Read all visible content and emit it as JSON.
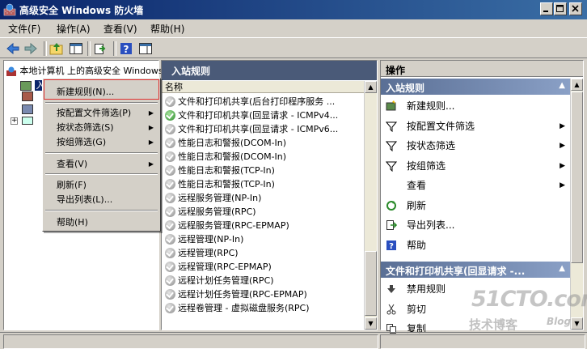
{
  "window": {
    "title": "高级安全 Windows 防火墙"
  },
  "menubar": [
    {
      "label": "文件(F)"
    },
    {
      "label": "操作(A)"
    },
    {
      "label": "查看(V)"
    },
    {
      "label": "帮助(H)"
    }
  ],
  "tree": {
    "root_label": "本地计算机 上的高级安全 Windows",
    "selected_label": "入站规则"
  },
  "context_menu": {
    "items": [
      {
        "label": "新建规则(N)...",
        "submenu": false
      },
      {
        "label": "按配置文件筛选(P)",
        "submenu": true
      },
      {
        "label": "按状态筛选(S)",
        "submenu": true
      },
      {
        "label": "按组筛选(G)",
        "submenu": true
      },
      {
        "label": "查看(V)",
        "submenu": true
      },
      {
        "label": "刷新(F)",
        "submenu": false
      },
      {
        "label": "导出列表(L)...",
        "submenu": false
      },
      {
        "label": "帮助(H)",
        "submenu": false
      }
    ]
  },
  "middle": {
    "title": "入站规则",
    "column_name": "名称",
    "rules": [
      {
        "name": "文件和打印机共享(后台打印程序服务 ...",
        "enabled": false
      },
      {
        "name": "文件和打印机共享(回显请求 - ICMPv4...",
        "enabled": true
      },
      {
        "name": "文件和打印机共享(回显请求 - ICMPv6...",
        "enabled": false
      },
      {
        "name": "性能日志和警报(DCOM-In)",
        "enabled": false
      },
      {
        "name": "性能日志和警报(DCOM-In)",
        "enabled": false
      },
      {
        "name": "性能日志和警报(TCP-In)",
        "enabled": false
      },
      {
        "name": "性能日志和警报(TCP-In)",
        "enabled": false
      },
      {
        "name": "远程服务管理(NP-In)",
        "enabled": false
      },
      {
        "name": "远程服务管理(RPC)",
        "enabled": false
      },
      {
        "name": "远程服务管理(RPC-EPMAP)",
        "enabled": false
      },
      {
        "name": "远程管理(NP-In)",
        "enabled": false
      },
      {
        "name": "远程管理(RPC)",
        "enabled": false
      },
      {
        "name": "远程管理(RPC-EPMAP)",
        "enabled": false
      },
      {
        "name": "远程计划任务管理(RPC)",
        "enabled": false
      },
      {
        "name": "远程计划任务管理(RPC-EPMAP)",
        "enabled": false
      },
      {
        "name": "远程卷管理 - 虚拟磁盘服务(RPC)",
        "enabled": false
      }
    ]
  },
  "actions": {
    "header": "操作",
    "section1": {
      "title": "入站规则",
      "items": [
        {
          "label": "新建规则...",
          "icon": "new-rule-icon",
          "submenu": false
        },
        {
          "label": "按配置文件筛选",
          "icon": "filter-icon",
          "submenu": true
        },
        {
          "label": "按状态筛选",
          "icon": "filter-icon",
          "submenu": true
        },
        {
          "label": "按组筛选",
          "icon": "filter-icon",
          "submenu": true
        },
        {
          "label": "查看",
          "icon": "view-icon",
          "submenu": true
        },
        {
          "label": "刷新",
          "icon": "refresh-icon",
          "submenu": false
        },
        {
          "label": "导出列表...",
          "icon": "export-icon",
          "submenu": false
        },
        {
          "label": "帮助",
          "icon": "help-icon",
          "submenu": false
        }
      ]
    },
    "section2": {
      "title": "文件和打印机共享(回显请求 -...",
      "items": [
        {
          "label": "禁用规则",
          "icon": "disable-icon"
        },
        {
          "label": "剪切",
          "icon": "cut-icon"
        },
        {
          "label": "复制",
          "icon": "copy-icon"
        }
      ]
    }
  },
  "watermark": {
    "main": "51CTO.com",
    "sub": "技术博客",
    "blog": "Blog"
  },
  "colors": {
    "title_bar": "#0a246a",
    "pane_header": "#4a5a78",
    "section_header": "#5a6f95",
    "enabled_rule": "#2b8a2b",
    "highlight_box": "#e03030"
  }
}
